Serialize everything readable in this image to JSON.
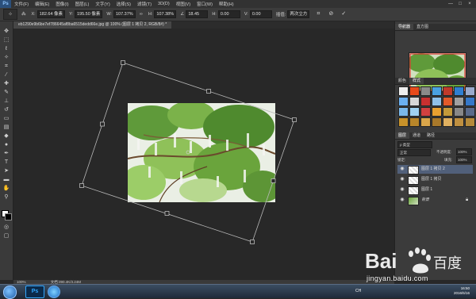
{
  "menubar": {
    "logo": "Ps",
    "items": [
      "文件(F)",
      "编辑(E)",
      "图像(I)",
      "图层(L)",
      "文字(Y)",
      "选择(S)",
      "滤镜(T)",
      "3D(D)",
      "视图(V)",
      "窗口(W)",
      "帮助(H)"
    ]
  },
  "window_controls": [
    "—",
    "□",
    "×"
  ],
  "options": {
    "x_label": "X:",
    "x_value": "182.64 像素",
    "y_label": "Y:",
    "y_value": "195.50 像素",
    "w_label": "W:",
    "w_value": "107.37%",
    "h_label": "H:",
    "h_value": "107.38%",
    "angle_value": "18.45",
    "hskew_label": "H:",
    "hskew_value": "0.00",
    "vskew_label": "V:",
    "vskew_value": "0.00",
    "interp_label": "插值:",
    "interp_value": "两次立方"
  },
  "document": {
    "tab_label": "eb1290e9b6be7ef786645af8ba6515dedd66e.jpg @ 100% (图层 1 拷贝 2, RGB/8#) *",
    "status_zoom": "100%",
    "status_doc": "文档:390.4K/3.24M"
  },
  "panels": {
    "navigator_tabs": [
      "导航器",
      "直方图"
    ],
    "swatch_tabs": [
      "颜色",
      "样式"
    ],
    "layers_tabs": [
      "图层",
      "通道",
      "路径"
    ],
    "kind_label": "ρ 类型",
    "blend_mode": "正常",
    "opacity_label": "不透明度:",
    "opacity_value": "100%",
    "lock_label": "锁定:",
    "fill_label": "填充:",
    "fill_value": "100%",
    "layers": [
      {
        "name": "图层 1 拷贝 2",
        "selected": true
      },
      {
        "name": "图层 1 拷贝",
        "selected": false
      },
      {
        "name": "图层 1",
        "selected": false
      },
      {
        "name": "背景",
        "selected": false
      }
    ]
  },
  "taskbar": {
    "apps": [
      "Ps"
    ],
    "lang": "CH",
    "time": "16:50",
    "date": "2016/5/16"
  },
  "watermark": {
    "text": "jingyan.baidu.com",
    "logo_text": "Bai 百度"
  },
  "colors": {
    "accent": "#2b4f7a",
    "selected_layer": "#51607a",
    "canvas_bg": "#282828"
  }
}
